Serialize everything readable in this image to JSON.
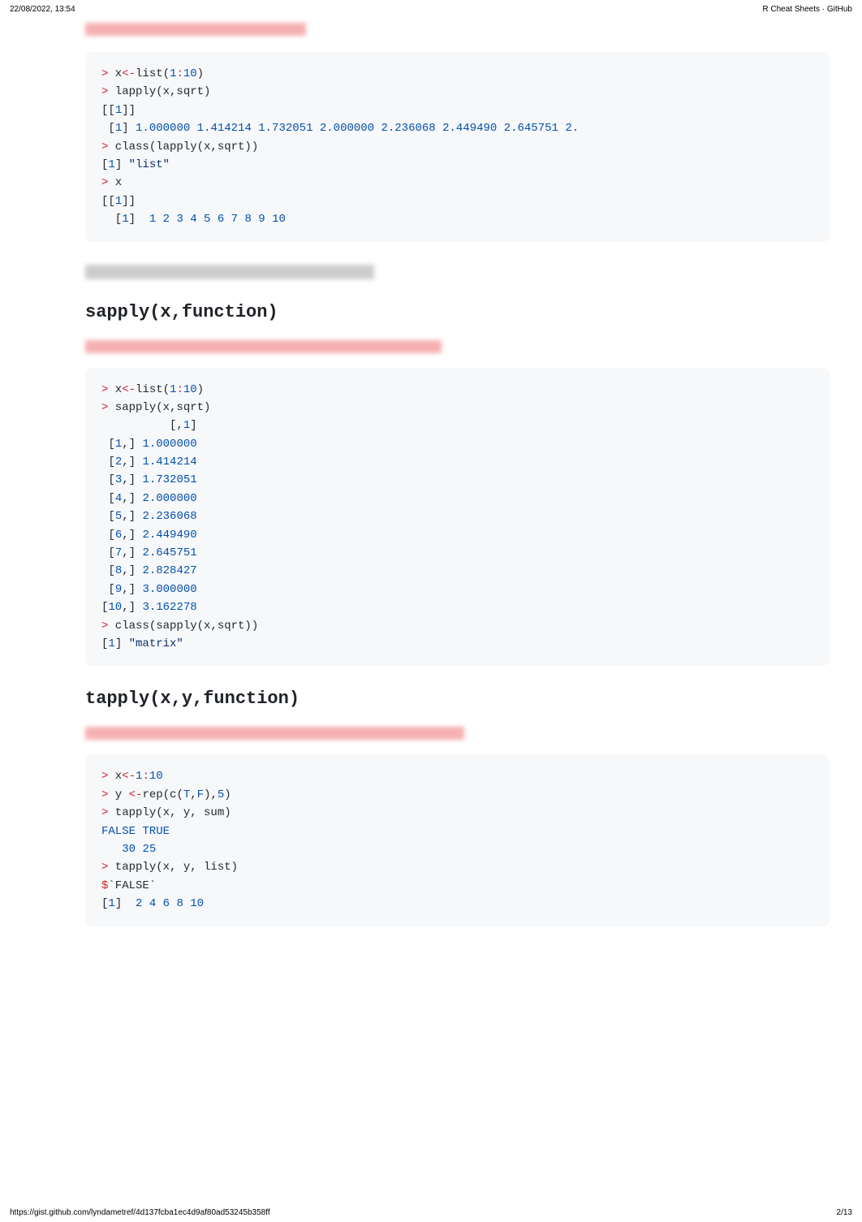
{
  "header": {
    "timestamp": "22/08/2022, 13:54",
    "title": "R Cheat Sheets · GitHub"
  },
  "blurred": {
    "intro1": "apply a function to each element of the list x",
    "divider1": "________________________________________",
    "intro2": "apply a function to each element of the list x with simplification of result",
    "intro3": "apply a function to subsets of a vector X and defined the subset by vector Y"
  },
  "sections": {
    "sapply_heading": "sapply(x,function)",
    "tapply_heading": "tapply(x,y,function)"
  },
  "footer": {
    "url": "https://gist.github.com/lyndametref/4d137fcba1ec4d9af80ad53245b358ff",
    "page": "2/13"
  },
  "code1": {
    "l1_gt": ">",
    "l1_x": " x",
    "l1_assign": "<-",
    "l1_list": "list",
    "l1_open": "(",
    "l1_1": "1",
    "l1_colon": ":",
    "l1_10": "10",
    "l1_close": ")",
    "l2_gt": ">",
    "l2_rest": " lapply(x,sqrt)",
    "l3_open": "[[",
    "l3_1": "1",
    "l3_close": "]]",
    "l4_sp": " [",
    "l4_1": "1",
    "l4_close": "] ",
    "l4_vals": "1.000000 1.414214 1.732051 2.000000 2.236068 2.449490 2.645751 2.",
    "l5_gt": ">",
    "l5_rest": " class(lapply(x,sqrt))",
    "l6_open": "[",
    "l6_1": "1",
    "l6_close": "] ",
    "l6_str": "\"list\"",
    "l7_gt": ">",
    "l7_rest": " x",
    "l8_open": "[[",
    "l8_1": "1",
    "l8_close": "]]",
    "l9_sp": "  [",
    "l9_1": "1",
    "l9_close": "]  ",
    "l9_vals": "1 2 3 4 5 6 7 8 9 10"
  },
  "code2": {
    "l1_gt": ">",
    "l1_x": " x",
    "l1_assign": "<-",
    "l1_list": "list",
    "l1_open": "(",
    "l1_1": "1",
    "l1_colon": ":",
    "l1_10": "10",
    "l1_close": ")",
    "l2_gt": ">",
    "l2_rest": " sapply(x,sqrt)",
    "l3_sp": "          [,",
    "l3_1": "1",
    "l3_close": "]",
    "r1_open": " [",
    "r1_n": "1",
    "r1_mid": ",] ",
    "r1_v": "1.000000",
    "r2_open": " [",
    "r2_n": "2",
    "r2_mid": ",] ",
    "r2_v": "1.414214",
    "r3_open": " [",
    "r3_n": "3",
    "r3_mid": ",] ",
    "r3_v": "1.732051",
    "r4_open": " [",
    "r4_n": "4",
    "r4_mid": ",] ",
    "r4_v": "2.000000",
    "r5_open": " [",
    "r5_n": "5",
    "r5_mid": ",] ",
    "r5_v": "2.236068",
    "r6_open": " [",
    "r6_n": "6",
    "r6_mid": ",] ",
    "r6_v": "2.449490",
    "r7_open": " [",
    "r7_n": "7",
    "r7_mid": ",] ",
    "r7_v": "2.645751",
    "r8_open": " [",
    "r8_n": "8",
    "r8_mid": ",] ",
    "r8_v": "2.828427",
    "r9_open": " [",
    "r9_n": "9",
    "r9_mid": ",] ",
    "r9_v": "3.000000",
    "r10_open": "[",
    "r10_n": "10",
    "r10_mid": ",] ",
    "r10_v": "3.162278",
    "lc_gt": ">",
    "lc_rest": " class(sapply(x,sqrt))",
    "lr_open": "[",
    "lr_1": "1",
    "lr_close": "] ",
    "lr_str": "\"matrix\""
  },
  "code3": {
    "l1_gt": ">",
    "l1_x": " x",
    "l1_assign": "<-",
    "l1_1": "1",
    "l1_colon": ":",
    "l1_10": "10",
    "l2_gt": ">",
    "l2_y": " y ",
    "l2_assign": "<-",
    "l2_rep": "rep(c(",
    "l2_T": "T",
    "l2_comma": ",",
    "l2_F": "F",
    "l2_close1": "),",
    "l2_5": "5",
    "l2_close2": ")",
    "l3_gt": ">",
    "l3_rest": " tapply(x, y, sum)",
    "l4": "FALSE TRUE",
    "l5_sp": "   ",
    "l5_30": "30",
    "l5_sp2": " ",
    "l5_25": "25",
    "l6_gt": ">",
    "l6_rest": " tapply(x, y, list)",
    "l7_dollar": "$",
    "l7_false": "`FALSE`",
    "l8_open": "[",
    "l8_1": "1",
    "l8_close": "]  ",
    "l8_vals": "2 4 6 8 10"
  }
}
